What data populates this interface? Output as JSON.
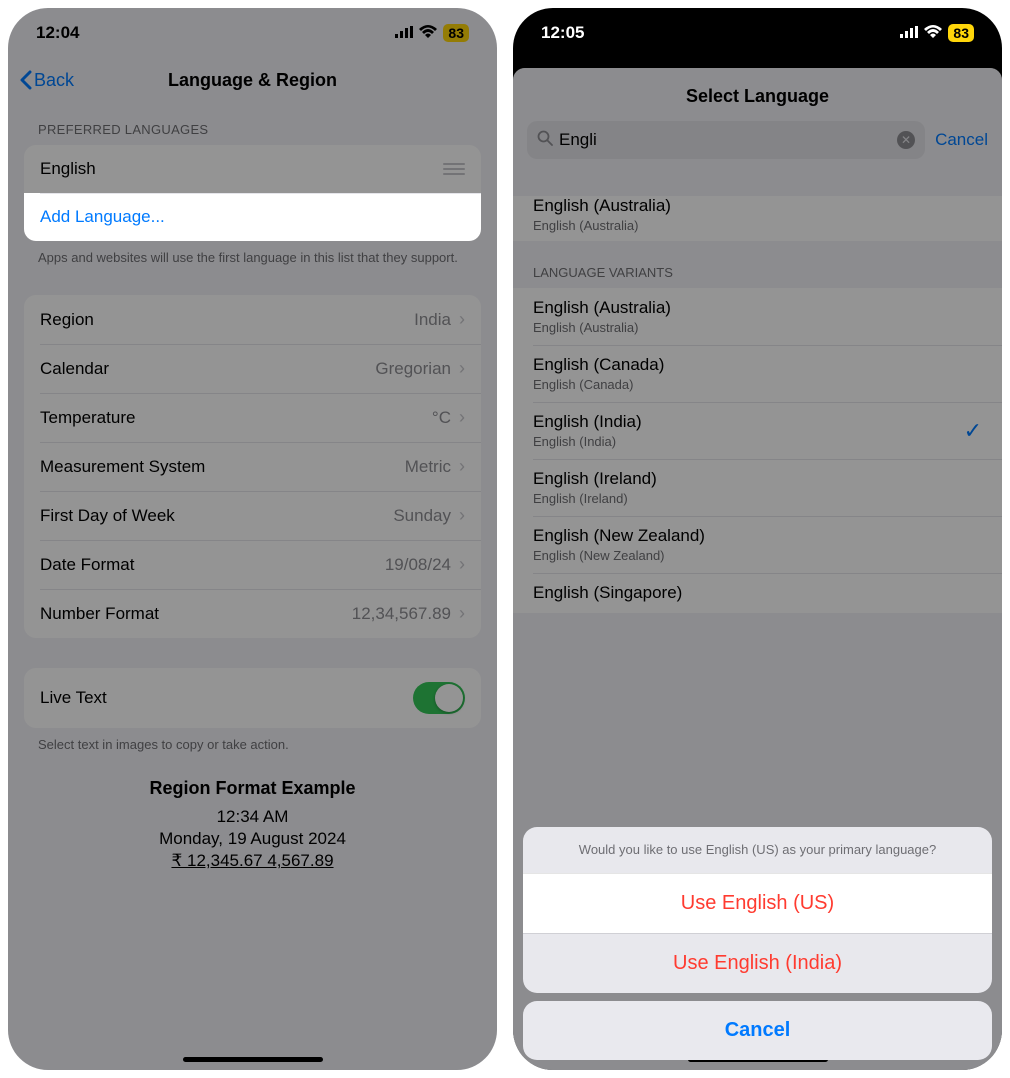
{
  "left": {
    "status": {
      "time": "12:04",
      "battery": "83"
    },
    "nav": {
      "back": "Back",
      "title": "Language & Region"
    },
    "preferred_header": "PREFERRED LANGUAGES",
    "english": "English",
    "add_language": "Add Language...",
    "footer": "Apps and websites will use the first language in this list that they support.",
    "rows": {
      "region": {
        "label": "Region",
        "value": "India"
      },
      "calendar": {
        "label": "Calendar",
        "value": "Gregorian"
      },
      "temperature": {
        "label": "Temperature",
        "value": "°C"
      },
      "measurement": {
        "label": "Measurement System",
        "value": "Metric"
      },
      "first_day": {
        "label": "First Day of Week",
        "value": "Sunday"
      },
      "date_format": {
        "label": "Date Format",
        "value": "19/08/24"
      },
      "number_format": {
        "label": "Number Format",
        "value": "12,34,567.89"
      }
    },
    "live_text": "Live Text",
    "live_text_footer": "Select text in images to copy or take action.",
    "example": {
      "title": "Region Format Example",
      "time": "12:34 AM",
      "date": "Monday, 19 August 2024",
      "numbers": "₹ 12,345.67   4,567.89"
    }
  },
  "right": {
    "status": {
      "time": "12:05",
      "battery": "83"
    },
    "title": "Select Language",
    "search": "Engli",
    "cancel": "Cancel",
    "partial": {
      "title": "English (Australia)",
      "sub": "English (Australia)"
    },
    "variants_header": "LANGUAGE VARIANTS",
    "variants": [
      {
        "title": "English (Australia)",
        "sub": "English (Australia)",
        "checked": false
      },
      {
        "title": "English (Canada)",
        "sub": "English (Canada)",
        "checked": false
      },
      {
        "title": "English (India)",
        "sub": "English (India)",
        "checked": true
      },
      {
        "title": "English (Ireland)",
        "sub": "English (Ireland)",
        "checked": false
      },
      {
        "title": "English (New Zealand)",
        "sub": "English (New Zealand)",
        "checked": false
      },
      {
        "title": "English (Singapore)",
        "sub": "",
        "checked": false
      }
    ],
    "action": {
      "message": "Would you like to use English (US) as your primary language?",
      "use_us": "Use English (US)",
      "use_india": "Use English (India)",
      "cancel": "Cancel"
    }
  }
}
